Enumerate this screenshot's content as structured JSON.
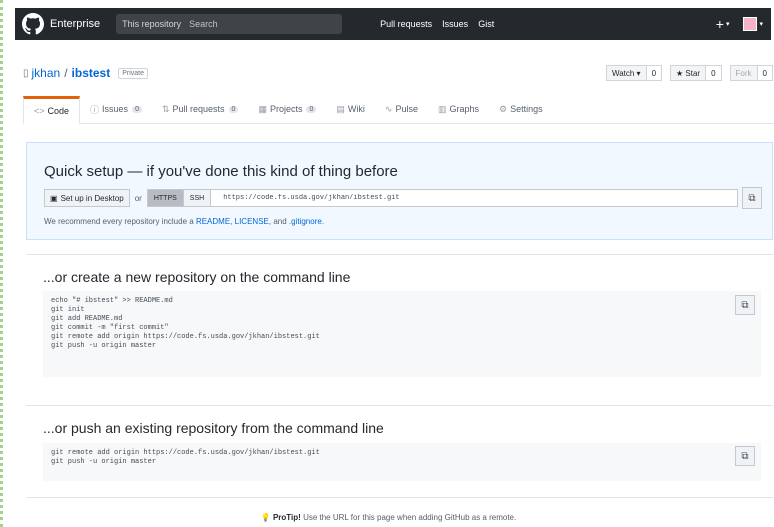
{
  "header": {
    "brand": "Enterprise",
    "search_scope": "This repository",
    "search_placeholder": "Search",
    "nav": [
      "Pull requests",
      "Issues",
      "Gist"
    ],
    "plus": "+",
    "caret": "▾"
  },
  "repo": {
    "owner": "jkhan",
    "separator": "/",
    "name": "ibstest",
    "visibility": "Private",
    "watch_label": "Watch ▾",
    "watch_count": "0",
    "star_label": "★ Star",
    "star_count": "0",
    "fork_label": "Fork",
    "fork_count": "0"
  },
  "tabs": [
    {
      "label": "Code",
      "icon": "<>",
      "count": ""
    },
    {
      "label": "Issues",
      "icon": "ⓘ",
      "count": "0"
    },
    {
      "label": "Pull requests",
      "icon": "⇅",
      "count": "0"
    },
    {
      "label": "Projects",
      "icon": "▦",
      "count": "0"
    },
    {
      "label": "Wiki",
      "icon": "▤",
      "count": ""
    },
    {
      "label": "Pulse",
      "icon": "∿",
      "count": ""
    },
    {
      "label": "Graphs",
      "icon": "▥",
      "count": ""
    },
    {
      "label": "Settings",
      "icon": "⚙",
      "count": ""
    }
  ],
  "quick_setup": {
    "title": "Quick setup — if you've done this kind of thing before",
    "desktop_button": "Set up in Desktop",
    "or": "or",
    "https": "HTTPS",
    "ssh": "SSH",
    "url": "https://code.fs.usda.gov/jkhan/ibstest.git",
    "recommend_prefix": "We recommend every repository include a",
    "readme": "README",
    "license": "LICENSE",
    "and": "and",
    "gitignore": ".gitignore"
  },
  "new_repo": {
    "title": "...or create a new repository on the command line",
    "code": "echo \"# ibstest\" >> README.md\ngit init\ngit add README.md\ngit commit -m \"first commit\"\ngit remote add origin https://code.fs.usda.gov/jkhan/ibstest.git\ngit push -u origin master"
  },
  "push_existing": {
    "title": "...or push an existing repository from the command line",
    "code": "git remote add origin https://code.fs.usda.gov/jkhan/ibstest.git\ngit push -u origin master"
  },
  "footer": {
    "pro_tip": "ProTip!",
    "text": "Use the URL for this page when adding GitHub as a remote."
  },
  "colors": {
    "header_bg": "#24292e",
    "link": "#0366d6",
    "quick_bg": "#f1f8ff",
    "selected_tab_accent": "#e36209"
  }
}
